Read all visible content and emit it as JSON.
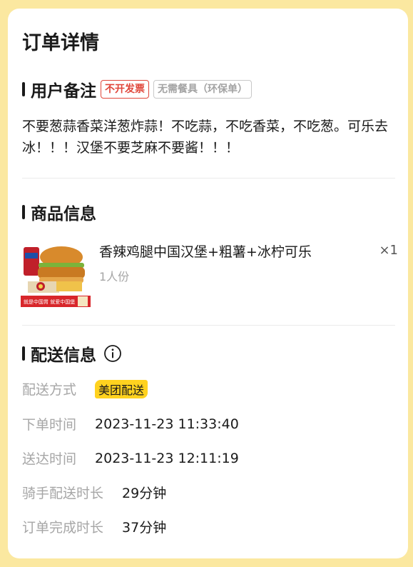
{
  "page": {
    "title": "订单详情"
  },
  "remark": {
    "section_title": "用户备注",
    "tags": [
      "不开发票",
      "无需餐具（环保单）"
    ],
    "text": "不要葱蒜香菜洋葱炸蒜！不吃蒜，不吃香菜，不吃葱。可乐去冰！！！汉堡不要芝麻不要酱！！！"
  },
  "product": {
    "section_title": "商品信息",
    "name": "香辣鸡腿中国汉堡+粗薯+冰柠可乐",
    "quantity": "×1",
    "portion": "1人份",
    "image_caption": "就是中国胃 就爱中国堡"
  },
  "delivery": {
    "section_title": "配送信息",
    "rows": [
      {
        "label": "配送方式",
        "value": "美团配送"
      },
      {
        "label": "下单时间",
        "value": "2023-11-23 11:33:40"
      },
      {
        "label": "送达时间",
        "value": "2023-11-23 12:11:19"
      },
      {
        "label": "骑手配送时长",
        "value": "29分钟"
      },
      {
        "label": "订单完成时长",
        "value": "37分钟"
      }
    ]
  },
  "colors": {
    "page_background": "#fbe8a0",
    "tag_red": "#e0463a",
    "badge_yellow": "#ffd21f",
    "label_gray": "#a6a6a6"
  },
  "icons": {
    "info": "info-circle-icon"
  }
}
